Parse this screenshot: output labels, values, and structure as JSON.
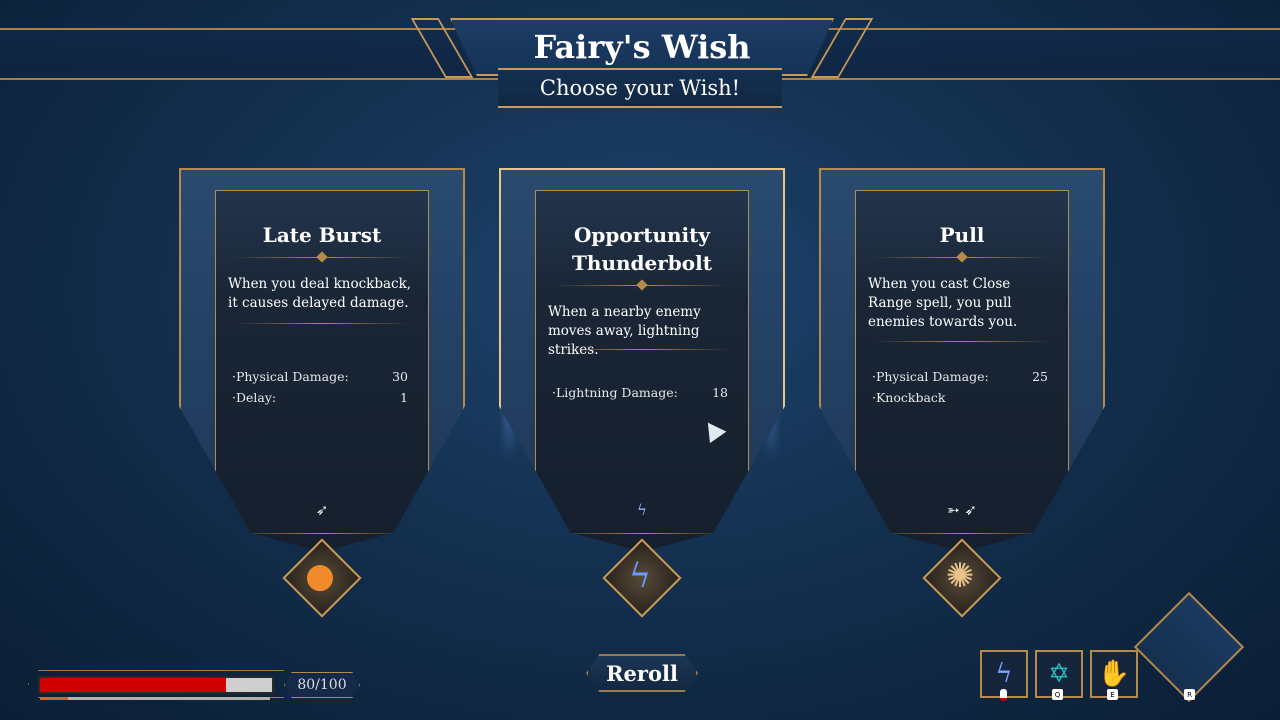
{
  "header": {
    "title": "Fairy's Wish",
    "subtitle": "Choose your Wish!"
  },
  "cards": [
    {
      "name": "Late Burst",
      "description": "When you deal knockback, it causes delayed damage.",
      "stats": [
        {
          "label": "·Physical Damage:",
          "value": "30"
        },
        {
          "label": "·Delay:",
          "value": "1"
        }
      ],
      "tag_icons": [
        "wind-icon"
      ],
      "selected": false
    },
    {
      "name": "Opportunity Thunderbolt",
      "description": "When a nearby enemy moves away, lightning strikes.",
      "stats": [
        {
          "label": "·Lightning Damage:",
          "value": "18"
        }
      ],
      "tag_icons": [
        "lightning-icon"
      ],
      "selected": true
    },
    {
      "name": "Pull",
      "description": "When you cast Close Range spell, you pull enemies towards you.",
      "stats": [
        {
          "label": "·Physical Damage:",
          "value": "25"
        },
        {
          "label": "·Knockback",
          "value": ""
        }
      ],
      "tag_icons": [
        "dash-icon",
        "wind-icon"
      ],
      "selected": false
    }
  ],
  "reroll": {
    "label": "Reroll"
  },
  "health": {
    "text": "80/100",
    "fraction": 0.8
  },
  "skills": [
    {
      "icon": "lightning-skill-icon",
      "key": ""
    },
    {
      "icon": "arcane-circle-skill-icon",
      "key": "Q"
    },
    {
      "icon": "fire-skill-icon",
      "key": "E"
    },
    {
      "icon": "empty-signature-slot",
      "key": "R"
    }
  ],
  "colors": {
    "gold": "#b88a4a",
    "hp_red": "#d10000",
    "background": "#13304f"
  }
}
